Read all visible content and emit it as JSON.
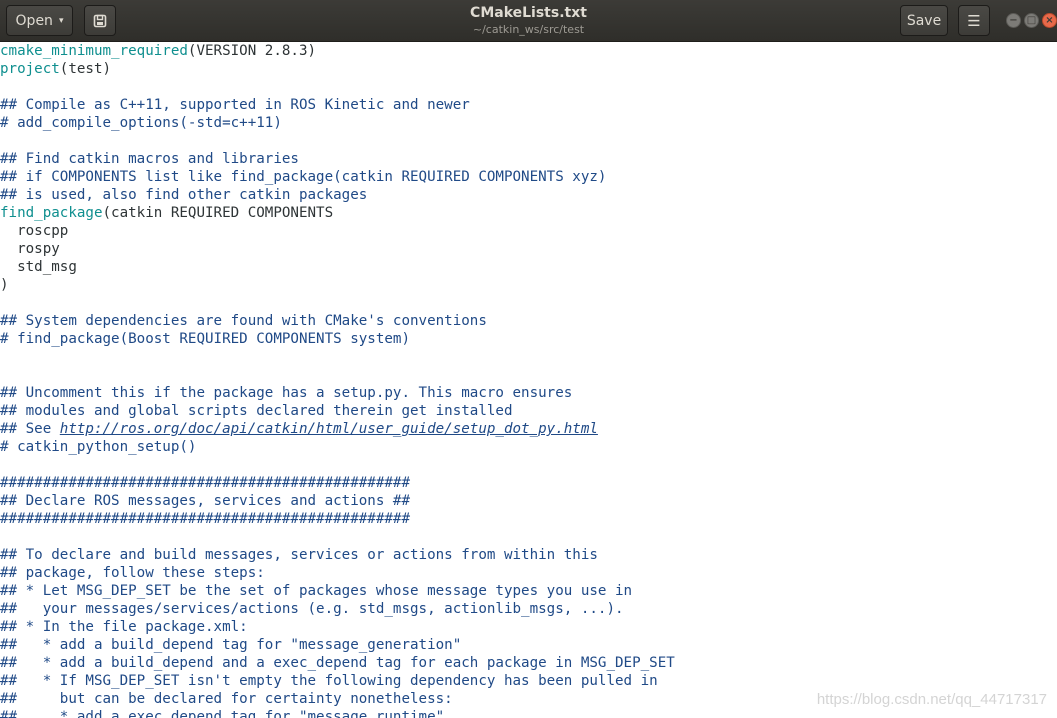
{
  "toolbar": {
    "open_label": "Open",
    "open_caret": "▾",
    "newtab_icon": "document-new-icon",
    "save_label": "Save",
    "menu_glyph": "☰"
  },
  "window": {
    "title": "CMakeLists.txt",
    "subtitle": "~/catkin_ws/src/test"
  },
  "colors": {
    "titlebar": "#3c3b37",
    "comment": "#204a87",
    "function": "#0f8f8f",
    "close_button": "#e8694a"
  },
  "editor": {
    "lines": [
      {
        "segments": [
          {
            "t": "cmake_minimum_required",
            "k": "fn"
          },
          {
            "t": "(VERSION 2.8.3)",
            "k": "plain"
          }
        ]
      },
      {
        "segments": [
          {
            "t": "project",
            "k": "fn"
          },
          {
            "t": "(test)",
            "k": "plain"
          }
        ]
      },
      {
        "segments": []
      },
      {
        "segments": [
          {
            "t": "## Compile as C++11, supported in ROS Kinetic and newer",
            "k": "cmt"
          }
        ]
      },
      {
        "segments": [
          {
            "t": "# add_compile_options(-std=c++11)",
            "k": "cmt"
          }
        ]
      },
      {
        "segments": []
      },
      {
        "segments": [
          {
            "t": "## Find catkin macros and libraries",
            "k": "cmt"
          }
        ]
      },
      {
        "segments": [
          {
            "t": "## if COMPONENTS list like find_package(catkin REQUIRED COMPONENTS xyz)",
            "k": "cmt"
          }
        ]
      },
      {
        "segments": [
          {
            "t": "## is used, also find other catkin packages",
            "k": "cmt"
          }
        ]
      },
      {
        "segments": [
          {
            "t": "find_package",
            "k": "fn"
          },
          {
            "t": "(catkin REQUIRED COMPONENTS",
            "k": "plain"
          }
        ]
      },
      {
        "segments": [
          {
            "t": "  roscpp",
            "k": "plain"
          }
        ]
      },
      {
        "segments": [
          {
            "t": "  rospy",
            "k": "plain"
          }
        ]
      },
      {
        "segments": [
          {
            "t": "  std_msg",
            "k": "plain"
          }
        ]
      },
      {
        "segments": [
          {
            "t": ")",
            "k": "plain"
          }
        ]
      },
      {
        "segments": []
      },
      {
        "segments": [
          {
            "t": "## System dependencies are found with CMake's conventions",
            "k": "cmt"
          }
        ]
      },
      {
        "segments": [
          {
            "t": "# find_package(Boost REQUIRED COMPONENTS system)",
            "k": "cmt"
          }
        ]
      },
      {
        "segments": []
      },
      {
        "segments": []
      },
      {
        "segments": [
          {
            "t": "## Uncomment this if the package has a setup.py. This macro ensures",
            "k": "cmt"
          }
        ]
      },
      {
        "segments": [
          {
            "t": "## modules and global scripts declared therein get installed",
            "k": "cmt"
          }
        ]
      },
      {
        "segments": [
          {
            "t": "## See ",
            "k": "cmt"
          },
          {
            "t": "http://ros.org/doc/api/catkin/html/user_guide/setup_dot_py.html",
            "k": "url"
          }
        ]
      },
      {
        "segments": [
          {
            "t": "# catkin_python_setup()",
            "k": "cmt"
          }
        ]
      },
      {
        "segments": []
      },
      {
        "segments": [
          {
            "t": "################################################",
            "k": "cmt"
          }
        ]
      },
      {
        "segments": [
          {
            "t": "## Declare ROS messages, services and actions ##",
            "k": "cmt"
          }
        ]
      },
      {
        "segments": [
          {
            "t": "################################################",
            "k": "cmt"
          }
        ]
      },
      {
        "segments": []
      },
      {
        "segments": [
          {
            "t": "## To declare and build messages, services or actions from within this",
            "k": "cmt"
          }
        ]
      },
      {
        "segments": [
          {
            "t": "## package, follow these steps:",
            "k": "cmt"
          }
        ]
      },
      {
        "segments": [
          {
            "t": "## * Let MSG_DEP_SET be the set of packages whose message types you use in",
            "k": "cmt"
          }
        ]
      },
      {
        "segments": [
          {
            "t": "##   your messages/services/actions (e.g. std_msgs, actionlib_msgs, ...).",
            "k": "cmt"
          }
        ]
      },
      {
        "segments": [
          {
            "t": "## * In the file package.xml:",
            "k": "cmt"
          }
        ]
      },
      {
        "segments": [
          {
            "t": "##   * add a build_depend tag for \"message_generation\"",
            "k": "cmt"
          }
        ]
      },
      {
        "segments": [
          {
            "t": "##   * add a build_depend and a exec_depend tag for each package in MSG_DEP_SET",
            "k": "cmt"
          }
        ]
      },
      {
        "segments": [
          {
            "t": "##   * If MSG_DEP_SET isn't empty the following dependency has been pulled in",
            "k": "cmt"
          }
        ]
      },
      {
        "segments": [
          {
            "t": "##     but can be declared for certainty nonetheless:",
            "k": "cmt"
          }
        ]
      },
      {
        "segments": [
          {
            "t": "##     * add a exec_depend tag for \"message_runtime\"",
            "k": "cmt"
          }
        ]
      }
    ]
  },
  "watermark": "https://blog.csdn.net/qq_44717317"
}
